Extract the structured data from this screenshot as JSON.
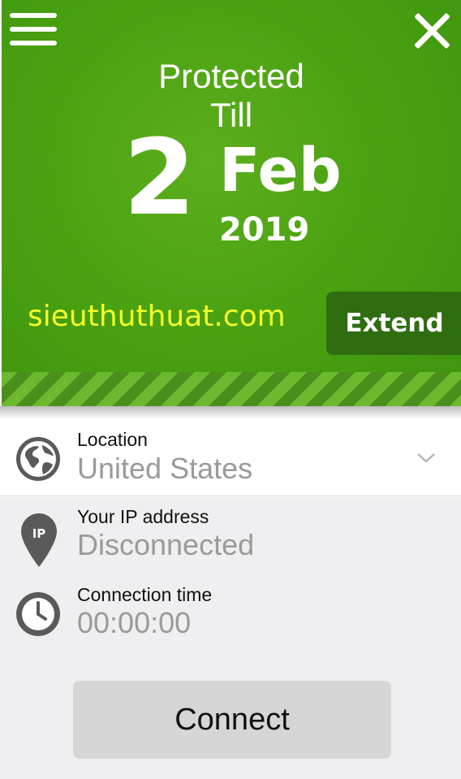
{
  "header": {
    "status_line1": "Protected",
    "status_line2": "Till",
    "expiry_day": "2",
    "expiry_month": "Feb",
    "expiry_year": "2019",
    "watermark": "sieuthuthuat.com",
    "extend_label": "Extend",
    "menu_icon": "hamburger-menu-icon",
    "close_icon": "close-icon"
  },
  "location": {
    "label": "Location",
    "value": "United States",
    "icon": "globe-icon",
    "dropdown_icon": "chevron-down-icon"
  },
  "ip": {
    "label": "Your IP address",
    "value": "Disconnected",
    "icon": "ip-pin-icon",
    "icon_text": "IP"
  },
  "time": {
    "label": "Connection time",
    "value": "00:00:00",
    "icon": "clock-icon"
  },
  "connect_label": "Connect",
  "colors": {
    "brand_green": "#48a010",
    "extend_bg": "#2f6e10",
    "watermark": "#f4ff2a",
    "button_gray": "#d6d6d6"
  }
}
